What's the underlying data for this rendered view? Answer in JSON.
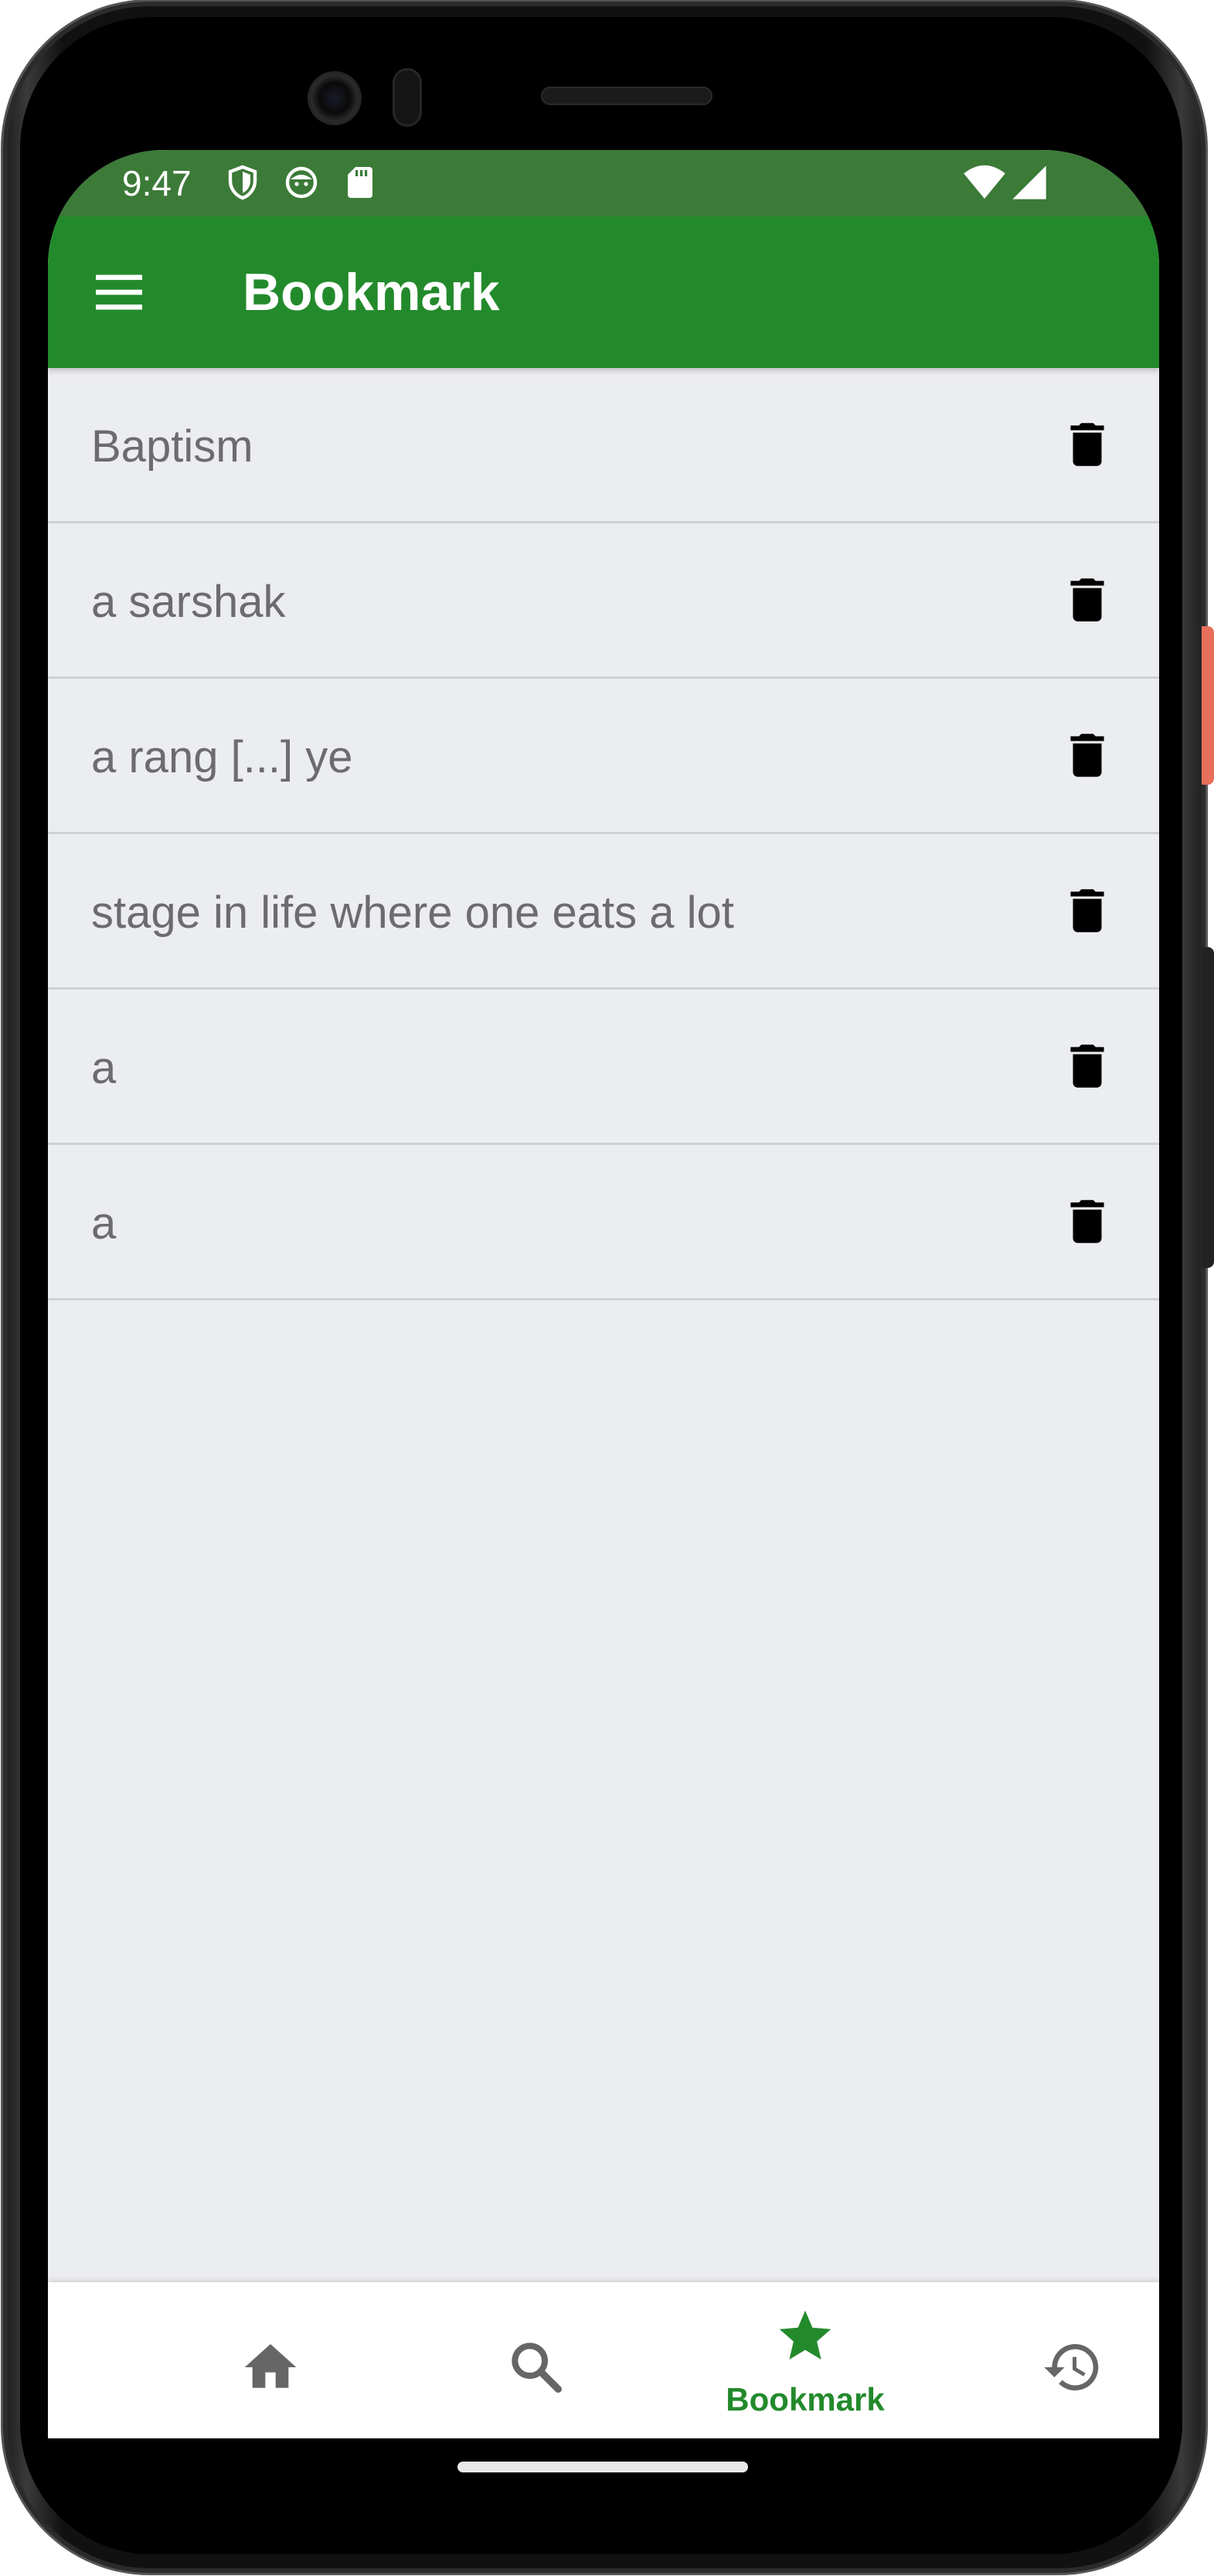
{
  "status_bar": {
    "time": "9:47",
    "icons": [
      "shield-icon",
      "face-icon",
      "sd-card-icon",
      "wifi-icon",
      "signal-icon"
    ]
  },
  "app_bar": {
    "title": "Bookmark",
    "menu_icon": "menu-icon",
    "background_color": "#238a2c"
  },
  "bookmarks": [
    {
      "label": "Baptism",
      "action_icon": "delete-icon"
    },
    {
      "label": "a sarshak",
      "action_icon": "delete-icon"
    },
    {
      "label": "a rang [...] ye",
      "action_icon": "delete-icon"
    },
    {
      "label": "stage in life where one eats a lot",
      "action_icon": "delete-icon"
    },
    {
      "label": "a",
      "action_icon": "delete-icon"
    },
    {
      "label": "a",
      "action_icon": "delete-icon"
    }
  ],
  "bottom_nav": {
    "items": [
      {
        "icon": "home-icon",
        "label": "",
        "active": false
      },
      {
        "icon": "search-icon",
        "label": "",
        "active": false
      },
      {
        "icon": "star-icon",
        "label": "Bookmark",
        "active": true
      },
      {
        "icon": "history-icon",
        "label": "",
        "active": false
      }
    ],
    "active_color": "#238a2c",
    "inactive_color": "#666666"
  }
}
